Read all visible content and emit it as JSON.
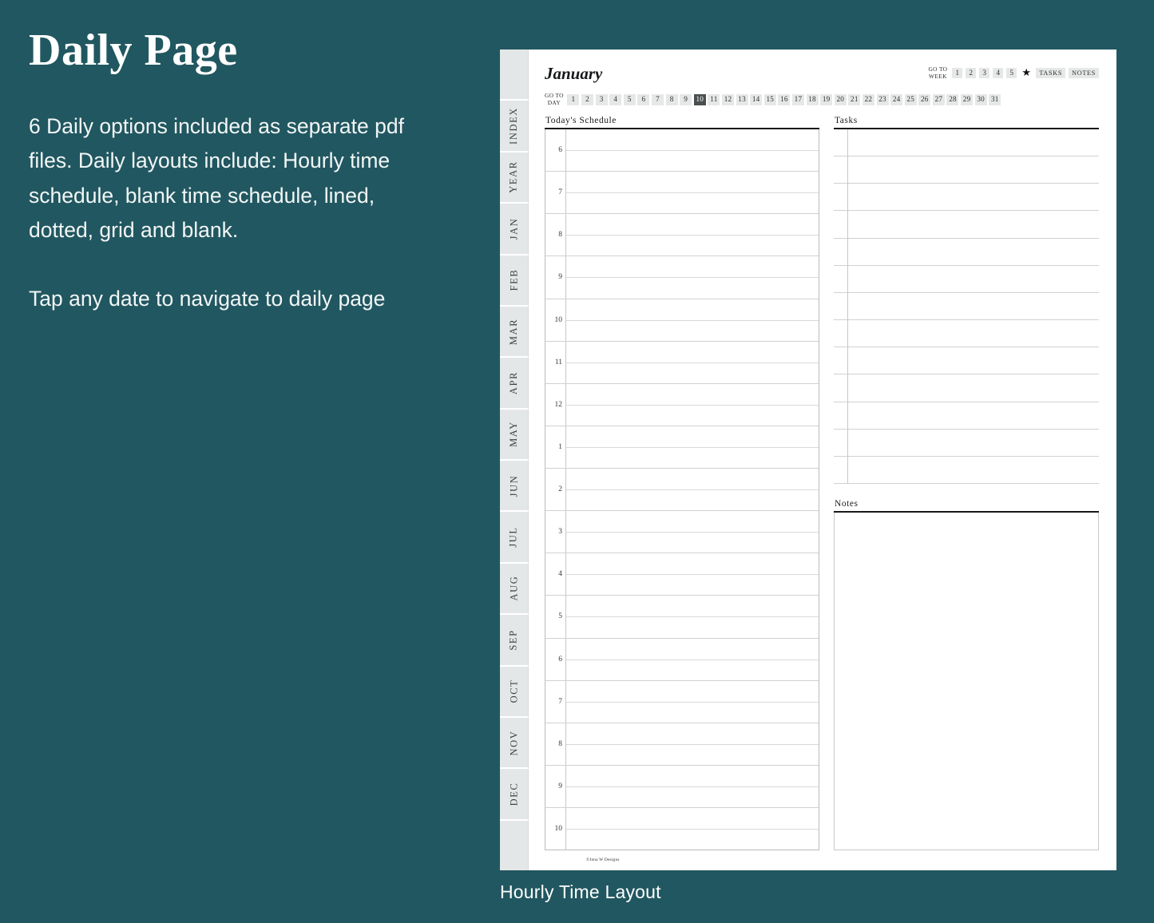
{
  "theme": {
    "background": "#215760",
    "page": "#ffffff",
    "chip": "#e6e8e8",
    "chip_active": "#4a4f50",
    "tab": "#e4e7e7",
    "ink": "#16181a"
  },
  "left_panel": {
    "title": "Daily Page",
    "paragraph_1": "6 Daily options included as separate pdf files. Daily layouts include: Hourly time schedule, blank time schedule, lined, dotted, grid and blank.",
    "paragraph_2": "Tap any date to navigate to daily page"
  },
  "caption": "Hourly Time Layout",
  "planner": {
    "month": "January",
    "copyright": "©Jena W Designs",
    "tabs": [
      "",
      "INDEX",
      "YEAR",
      "JAN",
      "FEB",
      "MAR",
      "APR",
      "MAY",
      "JUN",
      "JUL",
      "AUG",
      "SEP",
      "OCT",
      "NOV",
      "DEC",
      ""
    ],
    "week_nav": {
      "caption_line1": "GO TO",
      "caption_line2": "WEEK",
      "weeks": [
        "1",
        "2",
        "3",
        "4",
        "5"
      ],
      "star_icon": "★",
      "tasks_label": "TASKS",
      "notes_label": "NOTES"
    },
    "day_nav": {
      "caption_line1": "GO TO",
      "caption_line2": "DAY",
      "days": [
        "1",
        "2",
        "3",
        "4",
        "5",
        "6",
        "7",
        "8",
        "9",
        "10",
        "11",
        "12",
        "13",
        "14",
        "15",
        "16",
        "17",
        "18",
        "19",
        "20",
        "21",
        "22",
        "23",
        "24",
        "25",
        "26",
        "27",
        "28",
        "29",
        "30",
        "31"
      ],
      "active_day": "10"
    },
    "schedule": {
      "label": "Today's Schedule",
      "hours": [
        "6",
        "7",
        "8",
        "9",
        "10",
        "11",
        "12",
        "1",
        "2",
        "3",
        "4",
        "5",
        "6",
        "7",
        "8",
        "9",
        "10"
      ]
    },
    "tasks": {
      "label": "Tasks",
      "line_count": 13
    },
    "notes": {
      "label": "Notes"
    }
  }
}
